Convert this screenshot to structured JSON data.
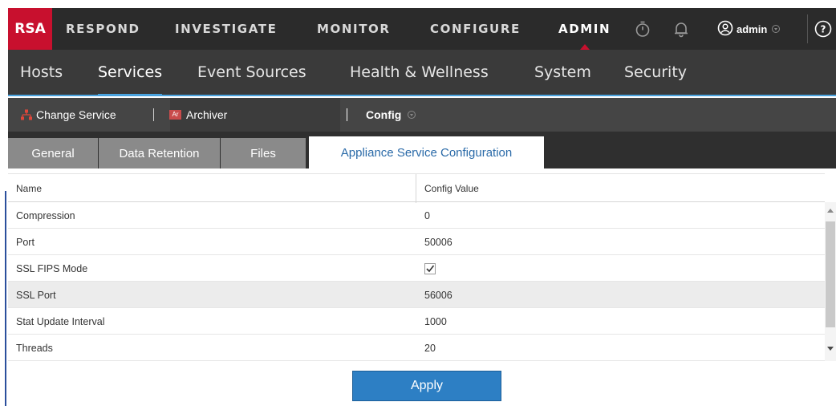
{
  "brand": {
    "logo_text": "RSA",
    "accent": "#c8102e"
  },
  "topnav": {
    "items": [
      "RESPOND",
      "INVESTIGATE",
      "MONITOR",
      "CONFIGURE",
      "ADMIN"
    ],
    "active": "ADMIN",
    "user": "admin"
  },
  "subnav": {
    "items": [
      "Hosts",
      "Services",
      "Event Sources",
      "Health & Wellness",
      "System",
      "Security"
    ],
    "active": "Services"
  },
  "servicebar": {
    "change_service_label": "Change Service",
    "service_badge": "Ar",
    "service_name": "Archiver",
    "view_label": "Config"
  },
  "tabs": {
    "items": [
      "General",
      "Data Retention",
      "Files",
      "Appliance Service Configuration"
    ],
    "active": "Appliance Service Configuration"
  },
  "grid": {
    "columns": [
      "Name",
      "Config Value"
    ],
    "rows": [
      {
        "name": "Compression",
        "value": "0"
      },
      {
        "name": "Port",
        "value": "50006"
      },
      {
        "name": "SSL FIPS Mode",
        "value": "",
        "checkbox": true,
        "checked": true
      },
      {
        "name": "SSL Port",
        "value": "56006",
        "selected": true
      },
      {
        "name": "Stat Update Interval",
        "value": "1000"
      },
      {
        "name": "Threads",
        "value": "20"
      }
    ]
  },
  "footer": {
    "apply_label": "Apply",
    "button_color": "#2d7fc4"
  }
}
